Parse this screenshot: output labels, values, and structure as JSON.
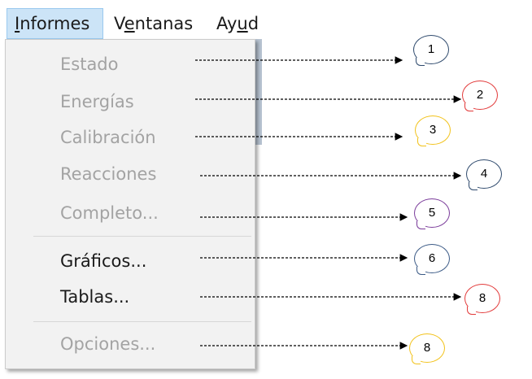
{
  "menubar": {
    "items": [
      {
        "label": "Informes",
        "underline": "I",
        "rest": "nformes"
      },
      {
        "label": "Ventanas",
        "before": "V",
        "underline": "e",
        "after": "ntanas"
      },
      {
        "label": "Ayuda",
        "before": "Ay",
        "underline": "u",
        "after": "d"
      }
    ]
  },
  "menu": {
    "items": [
      {
        "label": "Estado",
        "enabled": false
      },
      {
        "label": "Energías",
        "enabled": false
      },
      {
        "label": "Calibración",
        "enabled": false
      },
      {
        "label": "Reacciones",
        "enabled": false
      },
      {
        "label": "Completo...",
        "enabled": false
      },
      {
        "label": "Gráficos...",
        "enabled": true
      },
      {
        "label": "Tablas...",
        "enabled": true
      },
      {
        "label": "Opciones...",
        "enabled": false
      }
    ]
  },
  "callouts": [
    {
      "number": "1",
      "color": "#2f4a6d"
    },
    {
      "number": "2",
      "color": "#e23a3a"
    },
    {
      "number": "3",
      "color": "#f2c21a"
    },
    {
      "number": "4",
      "color": "#2f4a6d"
    },
    {
      "number": "5",
      "color": "#7a3b9a"
    },
    {
      "number": "6",
      "color": "#3b5a86"
    },
    {
      "number": "8",
      "color": "#e23a3a"
    },
    {
      "number": "8",
      "color": "#f2c21a"
    }
  ]
}
